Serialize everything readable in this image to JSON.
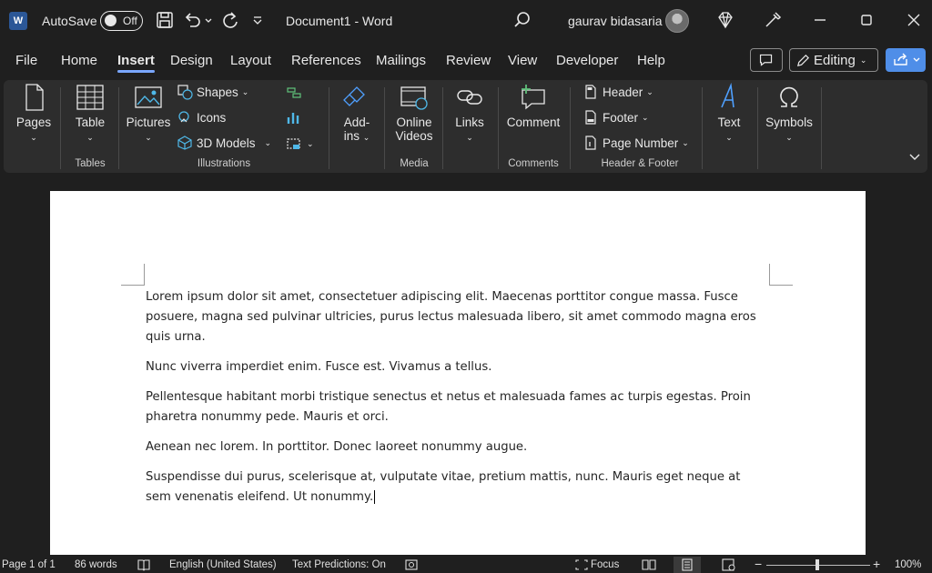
{
  "titlebar": {
    "app_logo": "W",
    "autosave_label": "AutoSave",
    "autosave_state": "Off",
    "doc_title": "Document1  -  Word",
    "user_name": "gaurav bidasaria"
  },
  "tabs": [
    "File",
    "Home",
    "Insert",
    "Design",
    "Layout",
    "References",
    "Mailings",
    "Review",
    "View",
    "Developer",
    "Help"
  ],
  "active_tab": "Insert",
  "right_actions": {
    "editing_label": "Editing"
  },
  "ribbon": {
    "pages": "Pages",
    "table": "Table",
    "pictures": "Pictures",
    "shapes": "Shapes",
    "icons": "Icons",
    "models3d": "3D Models",
    "addins_line1": "Add-",
    "addins_line2": "ins",
    "online_line1": "Online",
    "online_line2": "Videos",
    "links": "Links",
    "comment": "Comment",
    "header": "Header",
    "footer": "Footer",
    "page_number": "Page Number",
    "text": "Text",
    "symbols": "Symbols",
    "groups": {
      "tables": "Tables",
      "illustrations": "Illustrations",
      "media": "Media",
      "comments": "Comments",
      "header_footer": "Header & Footer"
    }
  },
  "document": {
    "paragraphs": [
      "Lorem ipsum dolor sit amet, consectetuer adipiscing elit. Maecenas porttitor congue massa. Fusce posuere, magna sed pulvinar ultricies, purus lectus malesuada libero, sit amet commodo magna eros quis urna.",
      "Nunc viverra imperdiet enim. Fusce est. Vivamus a tellus.",
      "Pellentesque habitant morbi tristique senectus et netus et malesuada fames ac turpis egestas. Proin pharetra nonummy pede. Mauris et orci.",
      "Aenean nec lorem. In porttitor. Donec laoreet nonummy augue.",
      "Suspendisse dui purus, scelerisque at, vulputate vitae, pretium mattis, nunc. Mauris eget neque at sem venenatis eleifend. Ut nonummy."
    ]
  },
  "status": {
    "page": "Page 1 of 1",
    "words": "86 words",
    "language": "English (United States)",
    "predictions": "Text Predictions: On",
    "focus": "Focus",
    "zoom": "100%",
    "zoom_minus": "−",
    "zoom_plus": "+"
  },
  "colors": {
    "accent": "#4f8ee8",
    "titlebar_bg": "#1f1f1f",
    "ribbon_bg": "#2d2d2d",
    "page_bg": "#ffffff"
  }
}
